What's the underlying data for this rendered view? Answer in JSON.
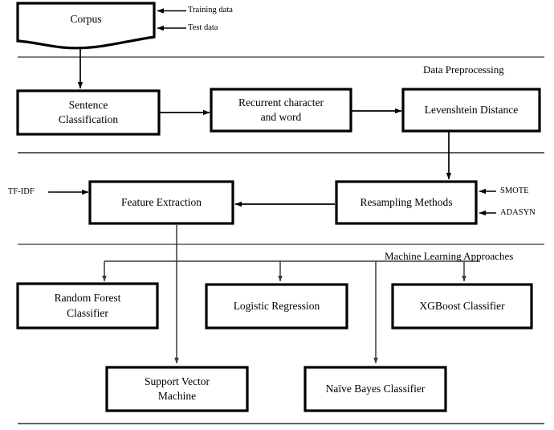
{
  "diagram": {
    "title": "Machine Learning Pipeline Flowchart",
    "stroke_color": "#000000",
    "connector_color": "#3a3a3a",
    "background_color": "#ffffff"
  },
  "bands": [
    {
      "id": "data-preprocessing",
      "label": "Data Preprocessing"
    },
    {
      "id": "machine-learning-approaches",
      "label": "Machine Learning Approaches"
    }
  ],
  "nodes": {
    "corpus": {
      "label": "Corpus",
      "shape": "document"
    },
    "sentence_classification": {
      "label": "Sentence\nClassification",
      "shape": "rect"
    },
    "recurrent_character_and_word": {
      "label": "Recurrent character\nand word",
      "shape": "rect"
    },
    "levenshtein_distance": {
      "label": "Levenshtein Distance",
      "shape": "rect"
    },
    "resampling_methods": {
      "label": "Resampling Methods",
      "shape": "rect"
    },
    "feature_extraction": {
      "label": "Feature Extraction",
      "shape": "rect"
    },
    "random_forest_classifier": {
      "label": "Random Forest\nClassifier",
      "shape": "rect"
    },
    "logistic_regression": {
      "label": "Logistic Regression",
      "shape": "rect"
    },
    "xgboost_classifier": {
      "label": "XGBoost Classifier",
      "shape": "rect"
    },
    "support_vector_machine": {
      "label": "Support Vector\nMachine",
      "shape": "rect"
    },
    "naive_bayes_classifier": {
      "label": "Naïve Bayes Classifier",
      "shape": "rect"
    }
  },
  "inputs": {
    "training_data": {
      "label": "Training data",
      "target": "corpus"
    },
    "test_data": {
      "label": "Test data",
      "target": "corpus"
    },
    "tf_idf": {
      "label": "TF-IDF",
      "target": "feature_extraction"
    },
    "smote": {
      "label": "SMOTE",
      "target": "resampling_methods"
    },
    "adasyn": {
      "label": "ADASYN",
      "target": "resampling_methods"
    }
  },
  "edges": [
    {
      "from": "corpus",
      "to": "sentence_classification"
    },
    {
      "from": "sentence_classification",
      "to": "recurrent_character_and_word"
    },
    {
      "from": "recurrent_character_and_word",
      "to": "levenshtein_distance"
    },
    {
      "from": "levenshtein_distance",
      "to": "resampling_methods"
    },
    {
      "from": "resampling_methods",
      "to": "feature_extraction"
    },
    {
      "from": "feature_extraction",
      "to": "random_forest_classifier"
    },
    {
      "from": "feature_extraction",
      "to": "logistic_regression"
    },
    {
      "from": "feature_extraction",
      "to": "xgboost_classifier"
    },
    {
      "from": "feature_extraction",
      "to": "support_vector_machine"
    },
    {
      "from": "feature_extraction",
      "to": "naive_bayes_classifier"
    }
  ]
}
